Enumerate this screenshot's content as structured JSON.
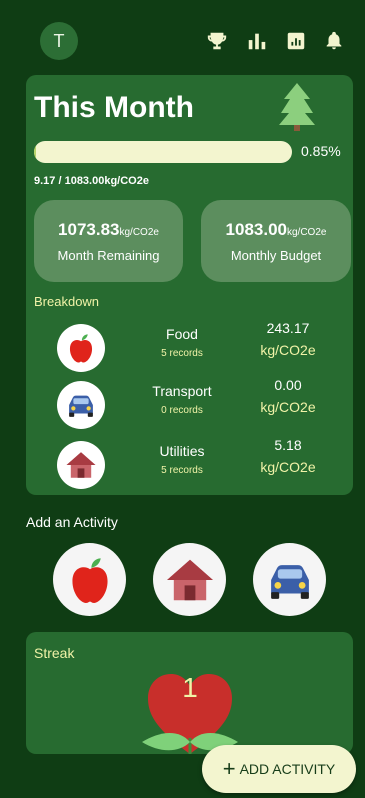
{
  "colors": {
    "background": "#0f3d14",
    "card": "#276b30",
    "stat_box": "#5c8e5e",
    "accent_text": "#f1f3a8",
    "progress_track": "#f3f5cf",
    "progress_fill": "#b8d36a"
  },
  "header": {
    "avatar_initial": "T",
    "icons": [
      "trophy-icon",
      "bar-chart-icon",
      "report-icon",
      "bell-icon"
    ]
  },
  "month": {
    "title": "This Month",
    "progress_percent_label": "0.85%",
    "progress_fraction": 0.0085,
    "progress_detail": "9.17 / 1083.00kg/CO2e",
    "remaining": {
      "value": "1073.83",
      "unit": "kg/CO2e",
      "label": "Month Remaining"
    },
    "budget": {
      "value": "1083.00",
      "unit": "kg/CO2e",
      "label": "Monthly Budget"
    },
    "breakdown_title": "Breakdown",
    "breakdown": [
      {
        "name": "Food",
        "records": "5 records",
        "amount": "243.17",
        "unit": "kg/CO2e",
        "icon": "apple-icon"
      },
      {
        "name": "Transport",
        "records": "0 records",
        "amount": "0.00",
        "unit": "kg/CO2e",
        "icon": "car-icon"
      },
      {
        "name": "Utilities",
        "records": "5 records",
        "amount": "5.18",
        "unit": "kg/CO2e",
        "icon": "house-icon"
      }
    ]
  },
  "add_activity": {
    "title": "Add an Activity",
    "buttons": [
      "apple-icon",
      "house-icon",
      "car-icon"
    ]
  },
  "streak": {
    "title": "Streak",
    "count": "1"
  },
  "fab": {
    "label": "ADD ACTIVITY"
  }
}
